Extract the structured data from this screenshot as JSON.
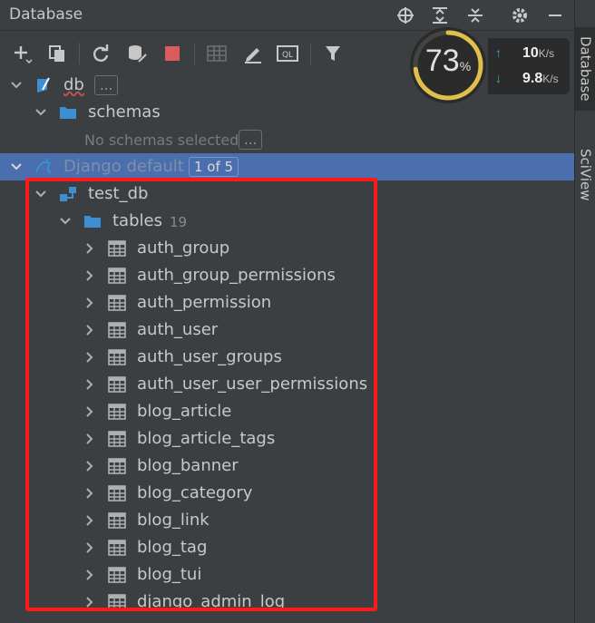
{
  "window": {
    "title": "Database"
  },
  "toolbar": {
    "items": [
      "add-icon",
      "duplicate-icon",
      "refresh-icon",
      "schema-settings-icon",
      "stop-icon",
      "table-icon",
      "edit-icon",
      "ql-console-icon",
      "filter-icon"
    ]
  },
  "tree": {
    "db": {
      "label": "db",
      "more": "..."
    },
    "schemas": {
      "label": "schemas"
    },
    "no_schemas": {
      "label": "No schemas selected",
      "more": "..."
    },
    "django": {
      "label": "Django default",
      "badge": "1 of 5"
    },
    "test_db": {
      "label": "test_db"
    },
    "tables": {
      "label": "tables",
      "count": "19"
    },
    "table_rows": [
      "auth_group",
      "auth_group_permissions",
      "auth_permission",
      "auth_user",
      "auth_user_groups",
      "auth_user_user_permissions",
      "blog_article",
      "blog_article_tags",
      "blog_banner",
      "blog_category",
      "blog_link",
      "blog_tag",
      "blog_tui",
      "django_admin_log"
    ]
  },
  "monitor": {
    "cpu_percent": "73",
    "cpu_unit": "%",
    "upload": "10",
    "upload_unit": "K/s",
    "download": "9.8",
    "download_unit": "K/s"
  },
  "side_tabs": [
    "Database",
    "SciView"
  ],
  "colors": {
    "selection": "#4b6eaf",
    "highlight_border": "#ff1a1a",
    "folder": "#3d8fd1"
  }
}
